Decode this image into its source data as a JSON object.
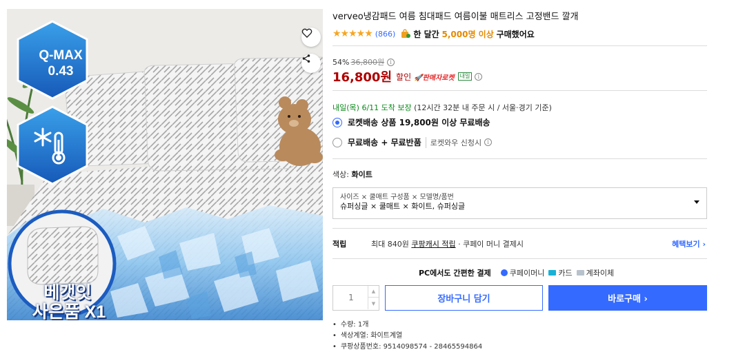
{
  "image": {
    "qmax_label": "Q-MAX",
    "qmax_value": "0.43",
    "gift_line1": "베갯잇",
    "gift_line2": "사은품 X1"
  },
  "title": "verveo냉감패드 여름 침대패드 여름이불 매트리스 고정밴드 깔개",
  "rating": {
    "stars": "★★★★★",
    "review_count": "(866)",
    "buy_prefix": "한 달간",
    "buy_count": "5,000명 이상",
    "buy_suffix": "구매했어요"
  },
  "price": {
    "discount_rate": "54%",
    "original_price": "36,800원",
    "sale_price": "16,800원",
    "sale_label": "할인",
    "seller_rocket": "🚀판매자로켓",
    "tomorrow_badge": "내일"
  },
  "delivery": {
    "date": "내일(목) 6/11 도착 보장",
    "condition": "(12시간 32분 내 주문 시 / 서울⋅경기 기준)"
  },
  "shipping_options": [
    {
      "bold": "로켓배송 상품 19,800원 이상 무료배송",
      "sub": "",
      "selected": true
    },
    {
      "bold": "무료배송 + 무료반품",
      "sub": "로켓와우 신청시",
      "selected": false
    }
  ],
  "color": {
    "label": "색상:",
    "value": "화이트"
  },
  "option": {
    "line1": "사이즈 × 쿨매트 구성품 × 모델명/품번",
    "line2": "슈퍼싱글 × 쿨매트 × 화이트, 슈퍼싱글"
  },
  "reward": {
    "label": "적립",
    "max": "최대 840원",
    "link": "쿠팡캐시 적립",
    "rest": "· 쿠페이 머니 결제시",
    "benefit": "혜택보기 ›"
  },
  "payment": {
    "title": "PC에서도 간편한 결제",
    "method1": "쿠페이머니",
    "method2": "카드",
    "method3": "계좌이체"
  },
  "purchase": {
    "quantity": "1",
    "cart_label": "장바구니 담기",
    "buy_label": "바로구매 ›"
  },
  "specs": [
    "수량: 1개",
    "색상계열: 화이트계열",
    "쿠팡상품번호: 9514098574 - 28465594864"
  ],
  "colors": {
    "accent": "#346aff",
    "price_red": "#ae0000",
    "star": "#f5a623",
    "green": "#0b8a1a"
  }
}
